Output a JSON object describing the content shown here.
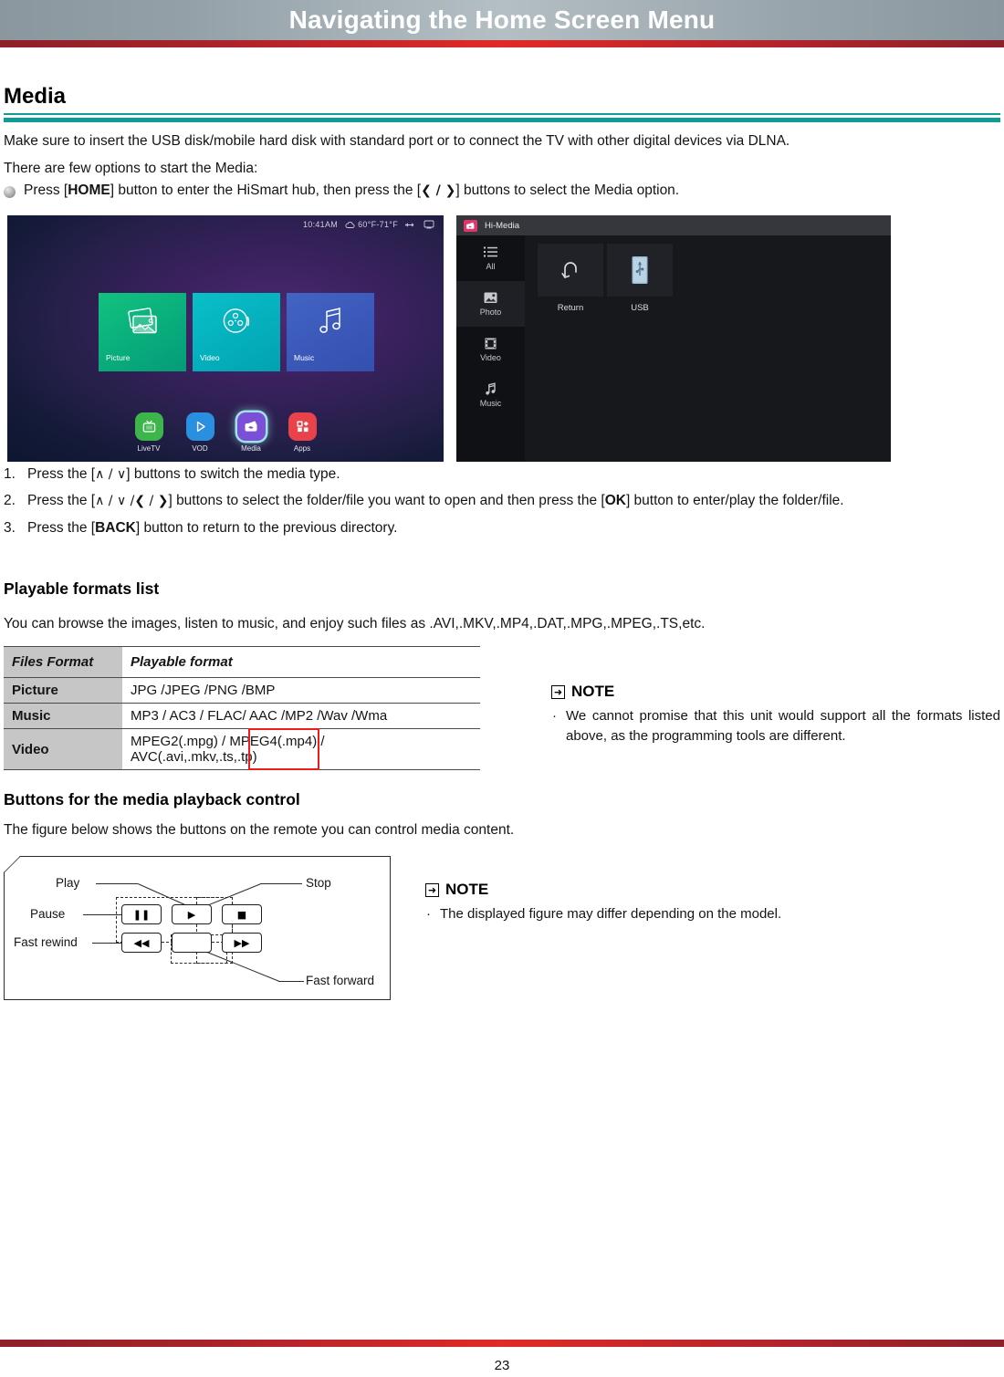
{
  "header": {
    "title": "Navigating the Home Screen Menu"
  },
  "section": {
    "title": "Media",
    "intro": "Make sure to insert the USB disk/mobile hard disk with standard port or to connect the TV with other digital devices via DLNA.",
    "options_lead": "There are few options to start the Media:",
    "bullet_text_1": "Press  [",
    "bullet_key": "HOME",
    "bullet_text_2": "] button to enter the HiSmart hub, then press the [",
    "bullet_keys": "❮ / ❯",
    "bullet_text_3": "] buttons to select the Media option."
  },
  "tv_home": {
    "status": {
      "time": "10:41AM",
      "temperature": "60°F-71°F",
      "weather_icon": "cloud-icon",
      "usb_icon": "usb-icon",
      "network_icon": "network-icon"
    },
    "tiles": [
      {
        "label": "Picture",
        "icon": "photos-icon",
        "color": "#08ab7c"
      },
      {
        "label": "Video",
        "icon": "film-reel-icon",
        "color": "#04aebb"
      },
      {
        "label": "Music",
        "icon": "music-note-icon",
        "color": "#3a57b8"
      }
    ],
    "dock": [
      {
        "label": "LiveTV",
        "icon": "tv-icon",
        "color": "#3cb54a",
        "selected": false
      },
      {
        "label": "VOD",
        "icon": "play-icon",
        "color": "#2a8fe0",
        "selected": false
      },
      {
        "label": "Media",
        "icon": "media-icon",
        "color": "#7b4fd6",
        "selected": true
      },
      {
        "label": "Apps",
        "icon": "grid-apps-icon",
        "color": "#e8434a",
        "selected": false
      }
    ]
  },
  "tv_media": {
    "title": "Hi-Media",
    "title_icon": "hi-media-icon",
    "sidebar": [
      {
        "label": "All",
        "icon": "list-icon",
        "active": false
      },
      {
        "label": "Photo",
        "icon": "photo-icon",
        "active": true
      },
      {
        "label": "Video",
        "icon": "film-icon",
        "active": false
      },
      {
        "label": "Music",
        "icon": "music-icon",
        "active": false
      }
    ],
    "items": [
      {
        "label": "Return",
        "icon": "return-arrow-icon"
      },
      {
        "label": "USB",
        "icon": "usb-drive-icon"
      }
    ]
  },
  "steps": [
    {
      "num": "1.",
      "prefix": "Press the [",
      "keys": "∧ / ∨",
      "suffix": "] buttons to switch the media type."
    },
    {
      "num": "2.",
      "prefix": "Press the [",
      "keys": "∧ / ∨ /❮ / ❯",
      "suffix": "] buttons to select the folder/file you want to open and then press the [",
      "key_bold": "OK",
      "suffix2": "] button to enter/play the folder/file."
    },
    {
      "num": "3.",
      "prefix": "Press the [",
      "key_bold": "BACK",
      "suffix": "] button to return to the previous directory."
    }
  ],
  "formats": {
    "heading": "Playable formats list",
    "intro": "You can browse the images, listen to music, and enjoy such files as .AVI,.MKV,.MP4,.DAT,.MPG,.MPEG,.TS,etc.",
    "columns": [
      "Files Format",
      "Playable format"
    ],
    "rows": [
      {
        "type": "Picture",
        "formats": "JPG /JPEG /PNG /BMP"
      },
      {
        "type": "Music",
        "formats": "MP3 / AC3 / FLAC/ AAC /MP2 /Wav /Wma"
      },
      {
        "type": "Video",
        "formats_line1": "MPEG2(.mpg) / MPEG4(.mp4) /",
        "formats_line2": "AVC(.avi,.mkv,.ts,.tp)"
      }
    ],
    "annotation_color": "#ee1c1c"
  },
  "note1": {
    "label": "NOTE",
    "icon": "note-arrow-icon",
    "bullet": "·",
    "text": "We cannot promise that this unit would support all the formats listed above, as the programming tools are different."
  },
  "note2": {
    "label": "NOTE",
    "icon": "note-arrow-icon",
    "bullet": "·",
    "text": "The displayed figure may differ depending on the model."
  },
  "playback": {
    "heading": "Buttons for the media playback control",
    "intro": "The figure below shows the buttons on the remote you can control media content.",
    "labels": {
      "play": "Play",
      "pause": "Pause",
      "fast_rewind": "Fast rewind",
      "stop": "Stop",
      "fast_forward": "Fast forward"
    },
    "buttons": [
      {
        "name": "pause",
        "glyph": "❚❚"
      },
      {
        "name": "play",
        "glyph": "▶"
      },
      {
        "name": "stop",
        "glyph": "■"
      },
      {
        "name": "fast-rewind",
        "glyph": "◀◀"
      },
      {
        "name": "blank",
        "glyph": ""
      },
      {
        "name": "fast-forward",
        "glyph": "▶▶"
      }
    ]
  },
  "footer": {
    "page_number": "23"
  }
}
